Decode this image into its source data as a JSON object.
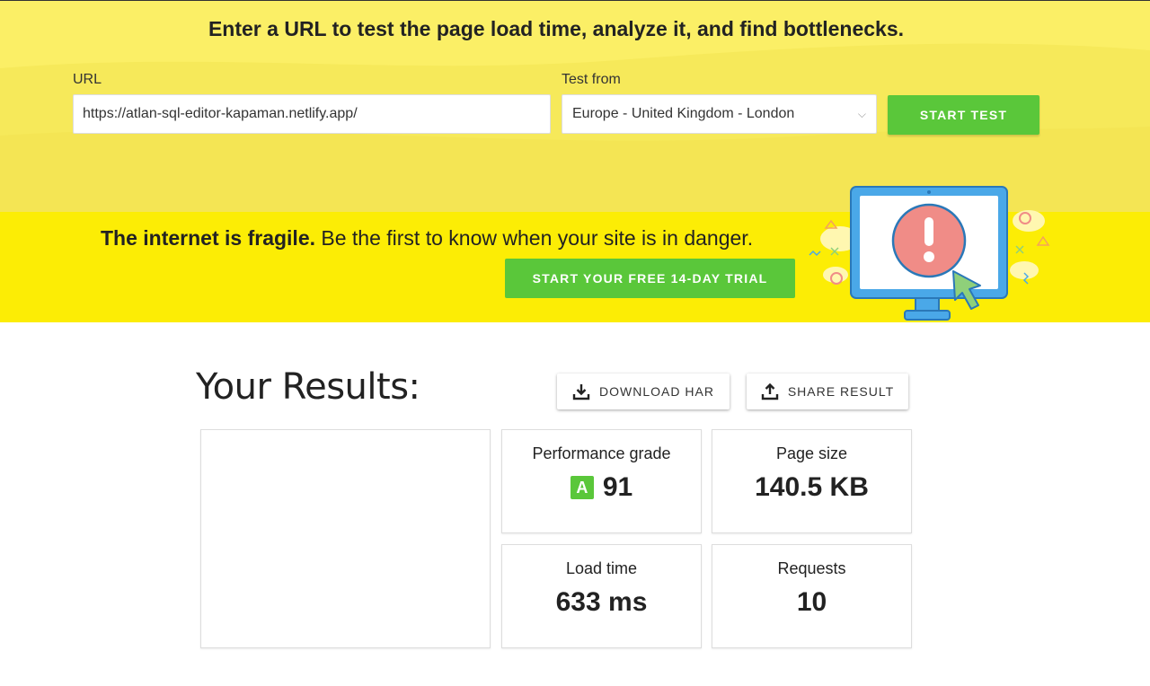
{
  "hero": {
    "title": "Enter a URL to test the page load time, analyze it, and find bottlenecks.",
    "url_label": "URL",
    "url_value": "https://atlan-sql-editor-kapaman.netlify.app/",
    "test_from_label": "Test from",
    "test_from_value": "Europe - United Kingdom - London",
    "start_button": "START TEST"
  },
  "banner": {
    "headline_bold": "The internet is fragile.",
    "headline_rest": " Be the first to know when your site is in danger.",
    "trial_button": "START YOUR FREE 14-DAY TRIAL"
  },
  "results": {
    "title": "Your Results:",
    "download_button": "DOWNLOAD HAR",
    "share_button": "SHARE RESULT",
    "metrics": {
      "performance_grade": {
        "label": "Performance grade",
        "grade": "A",
        "value": "91"
      },
      "page_size": {
        "label": "Page size",
        "value": "140.5 KB"
      },
      "load_time": {
        "label": "Load time",
        "value": "633 ms"
      },
      "requests": {
        "label": "Requests",
        "value": "10"
      }
    }
  },
  "colors": {
    "hero_bg": "#f6e95a",
    "banner_bg": "#fced05",
    "accent_green": "#5ac73a",
    "monitor_blue": "#4aa8e8",
    "alert_red": "#f08c87"
  },
  "icons": [
    "chevron-down-icon",
    "download-icon",
    "upload-share-icon",
    "alert-monitor-illustration",
    "cursor-arrow-icon"
  ]
}
